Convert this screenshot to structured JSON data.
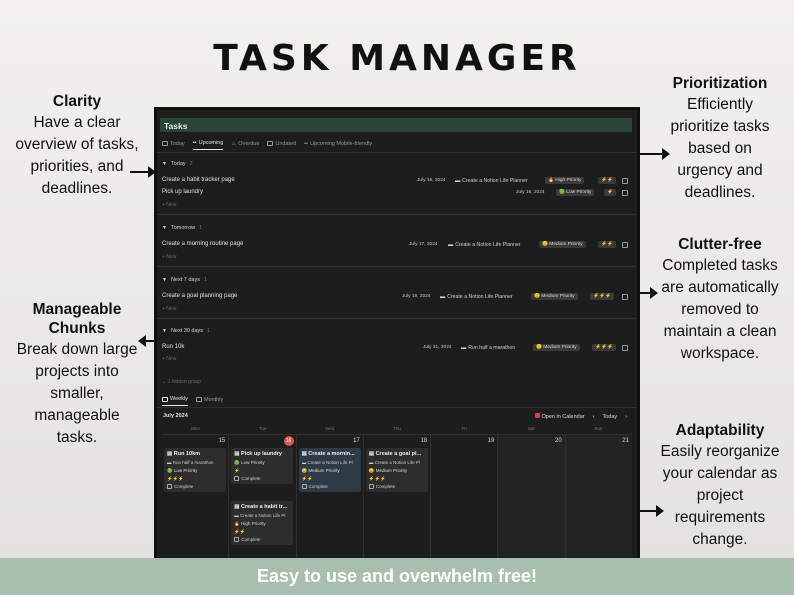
{
  "headline": "TASK MANAGER",
  "footer": "Easy to use and overwhelm free!",
  "callouts": {
    "clarity": {
      "title": "Clarity",
      "lines": [
        "Have a clear",
        "overview of tasks,",
        "priorities, and",
        "deadlines."
      ]
    },
    "chunks": {
      "title1": "Manageable",
      "title2": "Chunks",
      "lines": [
        "Break down large",
        "projects into",
        "smaller,",
        "manageable",
        "tasks."
      ]
    },
    "prioritization": {
      "title": "Prioritization",
      "lines": [
        "Efficiently",
        "prioritize tasks",
        "based on",
        "urgency and",
        "deadlines."
      ]
    },
    "clutter": {
      "title": "Clutter-free",
      "lines": [
        "Completed tasks",
        "are automatically",
        "removed to",
        "maintain a clean",
        "workspace."
      ]
    },
    "adaptability": {
      "title": "Adaptability",
      "lines": [
        "Easily reorganize",
        "your calendar as",
        "project",
        "requirements",
        "change."
      ]
    }
  },
  "app": {
    "title": "Tasks",
    "tabs": [
      "Today",
      "Upcoming",
      "Overdue",
      "Undated",
      "Upcoming Mobile-friendly"
    ],
    "active_tab": "Upcoming",
    "new_label": "+ New",
    "groups": [
      {
        "name": "Today",
        "count": "2"
      },
      {
        "name": "Tomorrow",
        "count": "1"
      },
      {
        "name": "Next 7 days",
        "count": "1"
      },
      {
        "name": "Next 30 days",
        "count": "1"
      }
    ],
    "rows": [
      {
        "name": "Create a habit tracker page",
        "date": "July 16, 2024",
        "project": "Create a Notion Life Planner",
        "priority": "🔥 High Priority",
        "energy": "⚡⚡"
      },
      {
        "name": "Pick up laundry",
        "date": "July 16, 2024",
        "project": "",
        "priority": "🟢 Low Priority",
        "energy": "⚡"
      },
      {
        "name": "Create a morning routine page",
        "date": "July 17, 2024",
        "project": "Create a Notion Life Planner",
        "priority": "😐 Medium Priority",
        "energy": "⚡⚡"
      },
      {
        "name": "Create a goal planning page",
        "date": "July 18, 2024",
        "project": "Create a Notion Life Planner",
        "priority": "😐 Medium Priority",
        "energy": "⚡⚡⚡"
      },
      {
        "name": "Run 10k",
        "date": "July 31, 2024",
        "project": "Run half a marathon",
        "priority": "😐 Medium Priority",
        "energy": "⚡⚡⚡"
      }
    ],
    "hidden_group": "1 hidden group",
    "view_tabs": [
      "Weekly",
      "Monthly"
    ],
    "month": "July 2024",
    "open_calendar": "Open in Calendar",
    "today_btn": "Today",
    "weekdays": [
      "Mon",
      "Tue",
      "Wed",
      "Thu",
      "Fri",
      "Sat",
      "Sun"
    ],
    "days": [
      "15",
      "16",
      "17",
      "18",
      "19",
      "20",
      "21"
    ],
    "cards": [
      {
        "title": "Run 10km",
        "project": "Run half a marathon",
        "priority": "🟢 Low Priority",
        "energy": "⚡⚡⚡",
        "complete": "Complete"
      },
      {
        "title": "Pick up laundry",
        "project": "",
        "priority": "🟢 Low Priority",
        "energy": "⚡",
        "complete": "Complete"
      },
      {
        "title": "Create a mornin...",
        "project": "Create a Notion Life Pl",
        "priority": "😐 Medium Priority",
        "energy": "⚡⚡",
        "complete": "Complete"
      },
      {
        "title": "Create a goal pl...",
        "project": "Create a Notion Life Pl",
        "priority": "😐 Medium Priority",
        "energy": "⚡⚡⚡",
        "complete": "Complete"
      },
      {
        "title": "Create a habit tr...",
        "project": "Create a Notion Life Pl",
        "priority": "🔥 High Priority",
        "energy": "⚡⚡",
        "complete": "Complete"
      }
    ]
  }
}
